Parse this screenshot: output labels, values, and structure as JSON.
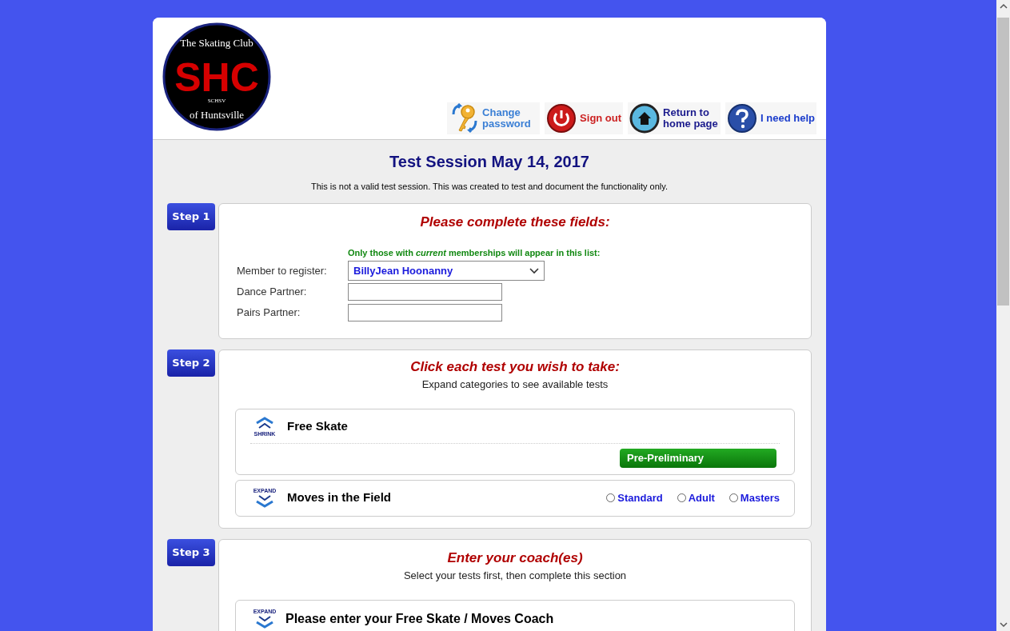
{
  "logo": {
    "top_text": "The Skating Club",
    "initials": "SHC",
    "rocket_text": "SCHSV",
    "bottom_text": "of Huntsville"
  },
  "header_links": [
    {
      "kind": "key",
      "label": "Change password",
      "color": "#3a7fd5"
    },
    {
      "kind": "power",
      "label": "Sign out",
      "color": "#cc2222"
    },
    {
      "kind": "home",
      "label": "Return to home page",
      "color": "#1a1a8c"
    },
    {
      "kind": "help",
      "label": "I need help",
      "color": "#1a3ccc"
    }
  ],
  "title": "Test Session May 14, 2017",
  "notice": "This is not a valid test session. This was created to test and document the functionality only.",
  "step1": {
    "badge": "Step 1",
    "heading": "Please complete these fields:",
    "hint": "Only those with *current* memberships will appear in this list:",
    "fields": [
      {
        "kind": "select",
        "label": "Member to register:",
        "value": "BillyJean Hoonanny"
      },
      {
        "kind": "text",
        "label": "Dance Partner:"
      },
      {
        "kind": "text",
        "label": "Pairs Partner:"
      }
    ]
  },
  "step2": {
    "badge": "Step 2",
    "heading": "Click each test you wish to take:",
    "subheading": "Expand categories to see available tests",
    "categories": [
      {
        "toggle": "SHRINK",
        "name": "Free Skate",
        "expanded": true,
        "tests": [
          "Pre-Preliminary"
        ]
      },
      {
        "toggle": "EXPAND",
        "name": "Moves in the Field",
        "expanded": false,
        "options": [
          {
            "label": "Standard",
            "selected": false
          },
          {
            "label": "Adult",
            "selected": false
          },
          {
            "label": "Masters",
            "selected": false
          }
        ]
      }
    ]
  },
  "step3": {
    "badge": "Step 3",
    "heading": "Enter your coach(es)",
    "subheading": "Select your tests first, then complete this section",
    "categories": [
      {
        "toggle": "EXPAND",
        "name": "Please enter your Free Skate / Moves Coach",
        "expanded": false
      }
    ]
  }
}
